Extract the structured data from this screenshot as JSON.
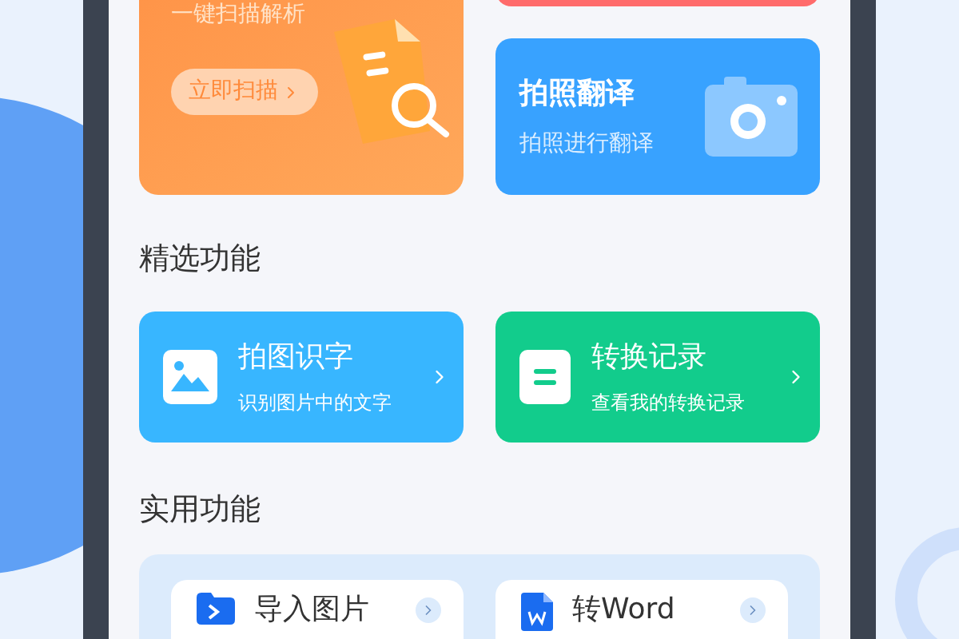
{
  "scan_card": {
    "subtitle": "一键扫描解析",
    "button": "立即扫描"
  },
  "translate_card": {
    "title": "拍照翻译",
    "subtitle": "拍照进行翻译"
  },
  "featured": {
    "title": "精选功能",
    "items": [
      {
        "kind": "image",
        "title": "拍图识字",
        "subtitle": "识别图片中的文字",
        "color": "#38b6ff"
      },
      {
        "kind": "record",
        "title": "转换记录",
        "subtitle": "查看我的转换记录",
        "color": "#12cc8c"
      }
    ]
  },
  "utility": {
    "title": "实用功能",
    "items": [
      {
        "kind": "folder",
        "label": "导入图片"
      },
      {
        "kind": "word",
        "label": "转Word"
      }
    ]
  }
}
